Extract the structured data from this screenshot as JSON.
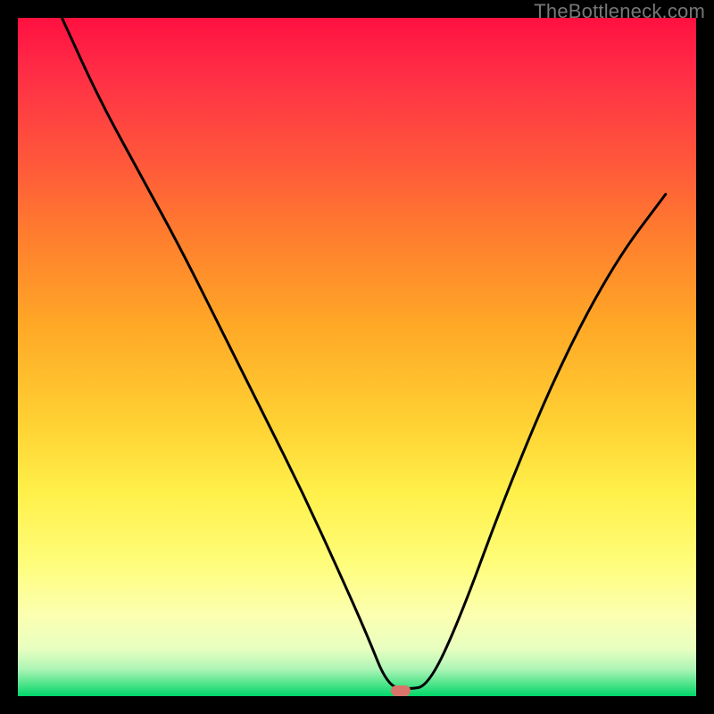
{
  "watermark": "TheBottleneck.com",
  "colors": {
    "frame": "#000000",
    "curve_stroke": "#000000",
    "marker_fill": "#d9746a",
    "gradient_stops": [
      "#ff1040",
      "#ff5a3a",
      "#ffa726",
      "#fff04a",
      "#fcffb0",
      "#00d66a"
    ]
  },
  "marker": {
    "x_frac": 0.565,
    "y_frac": 0.992
  },
  "chart_data": {
    "type": "line",
    "title": "",
    "xlabel": "",
    "ylabel": "",
    "xlim": [
      0,
      1
    ],
    "ylim": [
      0,
      1
    ],
    "note": "Axes are unlabeled in the source image; x and y are normalized plot-area fractions (0=left/bottom, 1=right/top). The curve is a V-shaped bottleneck profile with its minimum near x≈0.56.",
    "series": [
      {
        "name": "bottleneck-curve",
        "x": [
          0.065,
          0.12,
          0.18,
          0.24,
          0.3,
          0.36,
          0.42,
          0.475,
          0.515,
          0.545,
          0.575,
          0.605,
          0.65,
          0.72,
          0.8,
          0.88,
          0.955
        ],
        "y": [
          1.0,
          0.88,
          0.77,
          0.66,
          0.54,
          0.42,
          0.3,
          0.18,
          0.09,
          0.015,
          0.01,
          0.015,
          0.11,
          0.3,
          0.49,
          0.64,
          0.74
        ]
      }
    ],
    "flat_segment": {
      "x_start": 0.515,
      "x_end": 0.605,
      "y": 0.012
    },
    "minimum_at": {
      "x": 0.565,
      "y": 0.01
    }
  }
}
